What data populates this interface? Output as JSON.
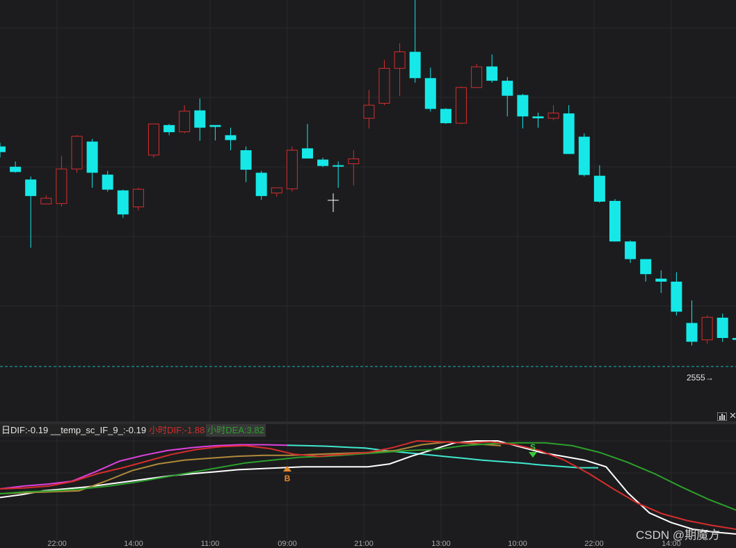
{
  "price_tag": "2555→",
  "watermark": "CSDN @期魔方",
  "legend": {
    "dif": "日DIF:-0.19 __temp_sc_IF_9_:-0.19",
    "hour_dif": "小时DIF:-1.88",
    "hour_dea": "小时DEA:3.82"
  },
  "signals": {
    "buy": "B",
    "sell": "S"
  },
  "icons": {
    "stats": "bar-chart-icon",
    "collapse": "close-x-icon"
  },
  "colors": {
    "up": "#d62d2d",
    "down": "#16e8e8",
    "background": "#1c1c1e",
    "daily_dif": "#e040e0",
    "daily_dif_late": "#40e8d0",
    "temp_line": "#b08a3a",
    "hour_dif": "#d62d2d",
    "hour_dea": "#2ca02c",
    "white_line": "#ffffff",
    "buy": "#e8892a",
    "sell": "#3cc83c"
  },
  "time_axis": [
    "22:00",
    "14:00",
    "11:00",
    "09:00",
    "21:00",
    "13:00",
    "10:00",
    "22:00",
    "14:00"
  ],
  "chart_data": {
    "type": "candlestick",
    "last_price": "2555",
    "candles": [
      {
        "o": 0.61,
        "h": 0.62,
        "l": 0.58,
        "c": 0.595,
        "dir": "down"
      },
      {
        "o": 0.556,
        "h": 0.57,
        "l": 0.54,
        "c": 0.542,
        "dir": "down"
      },
      {
        "o": 0.522,
        "h": 0.53,
        "l": 0.34,
        "c": 0.478,
        "dir": "down"
      },
      {
        "o": 0.472,
        "h": 0.48,
        "l": 0.46,
        "c": 0.457,
        "dir": "up"
      },
      {
        "o": 0.458,
        "h": 0.585,
        "l": 0.45,
        "c": 0.55,
        "dir": "up"
      },
      {
        "o": 0.55,
        "h": 0.64,
        "l": 0.54,
        "c": 0.637,
        "dir": "up"
      },
      {
        "o": 0.623,
        "h": 0.63,
        "l": 0.5,
        "c": 0.54,
        "dir": "down"
      },
      {
        "o": 0.535,
        "h": 0.545,
        "l": 0.49,
        "c": 0.495,
        "dir": "down"
      },
      {
        "o": 0.493,
        "h": 0.495,
        "l": 0.42,
        "c": 0.429,
        "dir": "down"
      },
      {
        "o": 0.449,
        "h": 0.5,
        "l": 0.44,
        "c": 0.496,
        "dir": "up"
      },
      {
        "o": 0.587,
        "h": 0.63,
        "l": 0.58,
        "c": 0.67,
        "dir": "up"
      },
      {
        "o": 0.667,
        "h": 0.67,
        "l": 0.64,
        "c": 0.648,
        "dir": "down"
      },
      {
        "o": 0.649,
        "h": 0.72,
        "l": 0.645,
        "c": 0.704,
        "dir": "up"
      },
      {
        "o": 0.706,
        "h": 0.738,
        "l": 0.625,
        "c": 0.66,
        "dir": "down"
      },
      {
        "o": 0.662,
        "h": 0.665,
        "l": 0.626,
        "c": 0.667,
        "dir": "down"
      },
      {
        "o": 0.64,
        "h": 0.66,
        "l": 0.6,
        "c": 0.627,
        "dir": "down"
      },
      {
        "o": 0.6,
        "h": 0.61,
        "l": 0.515,
        "c": 0.548,
        "dir": "down"
      },
      {
        "o": 0.54,
        "h": 0.545,
        "l": 0.468,
        "c": 0.478,
        "dir": "down"
      },
      {
        "o": 0.486,
        "h": 0.495,
        "l": 0.476,
        "c": 0.5,
        "dir": "up"
      },
      {
        "o": 0.497,
        "h": 0.61,
        "l": 0.49,
        "c": 0.6,
        "dir": "up"
      },
      {
        "o": 0.605,
        "h": 0.67,
        "l": 0.597,
        "c": 0.578,
        "dir": "down"
      },
      {
        "o": 0.575,
        "h": 0.58,
        "l": 0.555,
        "c": 0.558,
        "dir": "down"
      },
      {
        "o": 0.56,
        "h": 0.57,
        "l": 0.5,
        "c": 0.56,
        "dir": "down"
      },
      {
        "o": 0.564,
        "h": 0.6,
        "l": 0.506,
        "c": 0.577,
        "dir": "up"
      },
      {
        "o": 0.685,
        "h": 0.76,
        "l": 0.658,
        "c": 0.72,
        "dir": "up"
      },
      {
        "o": 0.725,
        "h": 0.84,
        "l": 0.72,
        "c": 0.818,
        "dir": "up"
      },
      {
        "o": 0.818,
        "h": 0.885,
        "l": 0.744,
        "c": 0.862,
        "dir": "up"
      },
      {
        "o": 0.862,
        "h": 1.0,
        "l": 0.78,
        "c": 0.792,
        "dir": "down"
      },
      {
        "o": 0.792,
        "h": 0.82,
        "l": 0.703,
        "c": 0.71,
        "dir": "down"
      },
      {
        "o": 0.71,
        "h": 0.712,
        "l": 0.67,
        "c": 0.672,
        "dir": "down"
      },
      {
        "o": 0.672,
        "h": 0.77,
        "l": 0.67,
        "c": 0.767,
        "dir": "up"
      },
      {
        "o": 0.767,
        "h": 0.83,
        "l": 0.77,
        "c": 0.822,
        "dir": "up"
      },
      {
        "o": 0.823,
        "h": 0.855,
        "l": 0.78,
        "c": 0.785,
        "dir": "down"
      },
      {
        "o": 0.785,
        "h": 0.795,
        "l": 0.69,
        "c": 0.745,
        "dir": "down"
      },
      {
        "o": 0.747,
        "h": 0.75,
        "l": 0.658,
        "c": 0.69,
        "dir": "down"
      },
      {
        "o": 0.69,
        "h": 0.7,
        "l": 0.66,
        "c": 0.685,
        "dir": "down"
      },
      {
        "o": 0.685,
        "h": 0.72,
        "l": 0.68,
        "c": 0.699,
        "dir": "up"
      },
      {
        "o": 0.698,
        "h": 0.72,
        "l": 0.59,
        "c": 0.59,
        "dir": "down"
      },
      {
        "o": 0.636,
        "h": 0.645,
        "l": 0.53,
        "c": 0.534,
        "dir": "down"
      },
      {
        "o": 0.532,
        "h": 0.56,
        "l": 0.46,
        "c": 0.463,
        "dir": "down"
      },
      {
        "o": 0.465,
        "h": 0.47,
        "l": 0.357,
        "c": 0.357,
        "dir": "down"
      },
      {
        "o": 0.357,
        "h": 0.36,
        "l": 0.3,
        "c": 0.31,
        "dir": "down"
      },
      {
        "o": 0.31,
        "h": 0.31,
        "l": 0.25,
        "c": 0.27,
        "dir": "down"
      },
      {
        "o": 0.258,
        "h": 0.28,
        "l": 0.22,
        "c": 0.25,
        "dir": "down"
      },
      {
        "o": 0.25,
        "h": 0.275,
        "l": 0.16,
        "c": 0.17,
        "dir": "down"
      },
      {
        "o": 0.14,
        "h": 0.2,
        "l": 0.08,
        "c": 0.09,
        "dir": "down"
      },
      {
        "o": 0.095,
        "h": 0.16,
        "l": 0.085,
        "c": 0.155,
        "dir": "up"
      },
      {
        "o": 0.154,
        "h": 0.165,
        "l": 0.09,
        "c": 0.1,
        "dir": "down"
      },
      {
        "o": 0.1,
        "h": 0.17,
        "l": 0.09,
        "c": 0.095,
        "dir": "down"
      }
    ],
    "indicator": {
      "daily_dif": [
        0.5,
        0.53,
        0.55,
        0.58,
        0.68,
        0.79,
        0.85,
        0.9,
        0.93,
        0.95,
        0.96,
        0.96,
        0.955,
        0.95,
        0.945,
        0.935,
        0.925,
        0.9,
        0.88,
        0.86,
        0.84,
        0.82,
        0.8,
        0.785,
        0.77,
        0.75,
        0.735,
        0.72,
        0.72
      ],
      "white_line": [
        0.41,
        0.44,
        0.48,
        0.5,
        0.52,
        0.55,
        0.58,
        0.61,
        0.64,
        0.66,
        0.68,
        0.7,
        0.71,
        0.72,
        0.73,
        0.73,
        0.73,
        0.73,
        0.76,
        0.84,
        0.91,
        0.98,
        1.0,
        1.0,
        0.94,
        0.88,
        0.84,
        0.8,
        0.73,
        0.46,
        0.25,
        0.15,
        0.08,
        0.05,
        0.03
      ],
      "temp_line": [
        0.45,
        0.46,
        0.47,
        0.48,
        0.58,
        0.69,
        0.76,
        0.8,
        0.82,
        0.84,
        0.85,
        0.85,
        0.86,
        0.87,
        0.88,
        0.9,
        0.96,
        0.99,
        0.97,
        0.95
      ],
      "hour_dif": [
        0.5,
        0.51,
        0.53,
        0.58,
        0.66,
        0.72,
        0.79,
        0.86,
        0.91,
        0.94,
        0.95,
        0.92,
        0.86,
        0.84,
        0.86,
        0.88,
        0.93,
        1.0,
        0.99,
        0.98,
        0.99,
        0.96,
        0.9,
        0.8,
        0.66,
        0.5,
        0.35,
        0.24,
        0.17,
        0.12,
        0.08
      ],
      "hour_dea": [
        0.45,
        0.47,
        0.48,
        0.5,
        0.53,
        0.57,
        0.62,
        0.67,
        0.72,
        0.77,
        0.8,
        0.83,
        0.84,
        0.86,
        0.88,
        0.9,
        0.91,
        0.95,
        0.97,
        0.98,
        0.98,
        0.95,
        0.88,
        0.78,
        0.66,
        0.52,
        0.39,
        0.28
      ],
      "buy_index": 12,
      "sell_index": 22
    }
  }
}
